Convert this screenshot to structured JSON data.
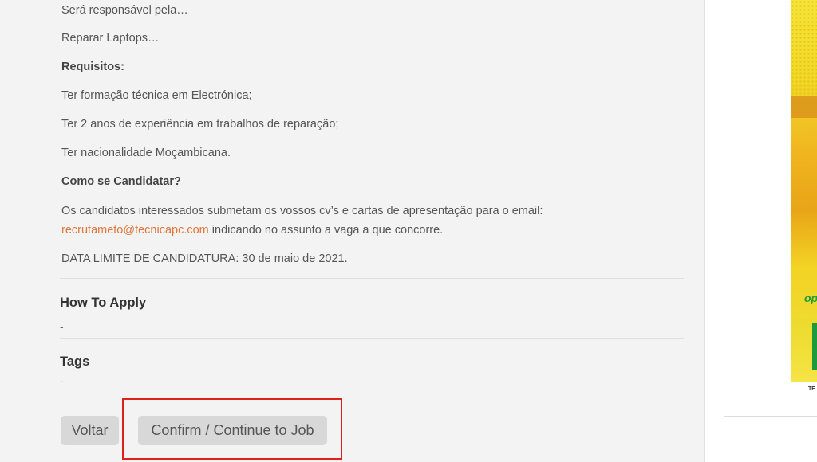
{
  "job": {
    "paragraphs": [
      "Será responsável pela…",
      "Reparar Laptops…",
      "Requisitos:",
      "Ter formação técnica em Electrónica;",
      "Ter 2 anos de experiência em trabalhos de reparação;",
      "Ter nacionalidade Moçambicana.",
      "Como se Candidatar?",
      "Os candidatos interessados submetam os vossos cv’s e cartas de apresentação para o email:"
    ],
    "email": "recrutameto@tecnicapc.com",
    "email_suffix": " indicando no assunto a vaga a que concorre.",
    "deadline": "DATA LIMITE DE CANDIDATURA: 30 de maio de 2021."
  },
  "how_to_apply": {
    "title": "How To Apply",
    "value": "-"
  },
  "tags": {
    "title": "Tags",
    "value": "-"
  },
  "actions": {
    "back_label": "Voltar",
    "confirm_label": "Confirm / Continue to Job"
  },
  "ad": {
    "partial_text": "op",
    "footer_text": "TE"
  },
  "colors": {
    "link": "#e0763a",
    "highlight": "#e0201b",
    "button_bg": "#d8d8d8"
  }
}
